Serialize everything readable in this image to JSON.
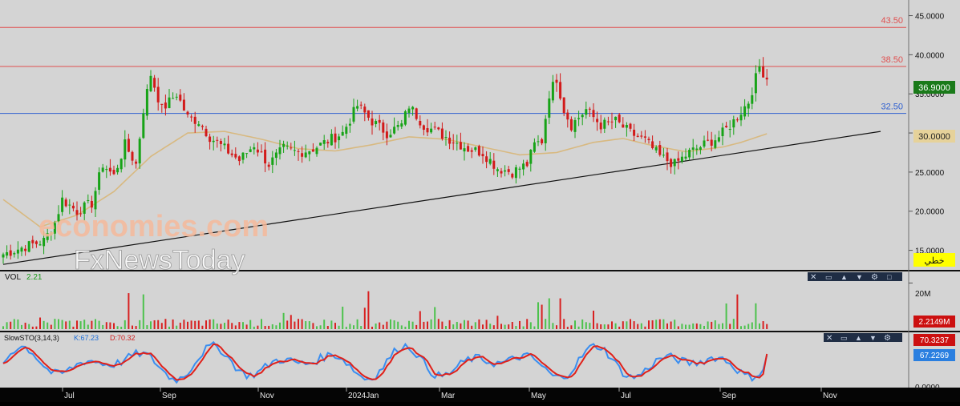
{
  "chart_data": [
    {
      "type": "candlestick",
      "name": "price",
      "ylim": [
        12.5,
        47
      ],
      "y_ticks": [
        "15.0000",
        "20.0000",
        "25.0000",
        "30.0000",
        "35.0000",
        "40.0000",
        "45.0000"
      ],
      "y_tick_values": [
        15,
        20,
        25,
        30,
        35,
        40,
        45
      ],
      "x_ticks": [
        "Jul",
        "Sep",
        "Nov",
        "2024Jan",
        "Mar",
        "May",
        "Jul",
        "Sep",
        "Nov"
      ],
      "last_price": "36.9000",
      "ma_value": "30.0000",
      "levels": [
        {
          "label": "43.50",
          "value": 43.5,
          "color": "#e05050"
        },
        {
          "label": "38.50",
          "value": 38.5,
          "color": "#e05050"
        },
        {
          "label": "32.50",
          "value": 32.5,
          "color": "#3060d0"
        }
      ],
      "trendline": {
        "from": [
          "Jun 2023",
          13.2
        ],
        "to": [
          "Nov 2024",
          30.2
        ]
      },
      "price_path": [
        [
          0,
          14.5
        ],
        [
          6,
          15.5
        ],
        [
          11,
          16.2
        ],
        [
          14,
          18.5
        ],
        [
          16,
          21.5
        ],
        [
          20,
          20.0
        ],
        [
          24,
          21.0
        ],
        [
          27,
          26.0
        ],
        [
          30,
          24.5
        ],
        [
          33,
          28.5
        ],
        [
          36,
          26.0
        ],
        [
          38,
          33.0
        ],
        [
          40,
          37.5
        ],
        [
          43,
          33.0
        ],
        [
          47,
          35.0
        ],
        [
          50,
          32.0
        ],
        [
          53,
          31.5
        ],
        [
          56,
          29.5
        ],
        [
          60,
          28.0
        ],
        [
          64,
          26.5
        ],
        [
          68,
          28.5
        ],
        [
          72,
          26.0
        ],
        [
          76,
          28.0
        ],
        [
          80,
          27.5
        ],
        [
          84,
          28.0
        ],
        [
          88,
          29.0
        ],
        [
          92,
          30.0
        ],
        [
          96,
          33.5
        ],
        [
          100,
          31.5
        ],
        [
          104,
          30.0
        ],
        [
          108,
          31.0
        ],
        [
          110,
          33.5
        ],
        [
          114,
          31.0
        ],
        [
          118,
          30.0
        ],
        [
          122,
          29.0
        ],
        [
          126,
          28.0
        ],
        [
          130,
          27.5
        ],
        [
          134,
          25.5
        ],
        [
          138,
          25.0
        ],
        [
          142,
          26.0
        ],
        [
          144,
          28.5
        ],
        [
          146,
          29.0
        ],
        [
          148,
          35.0
        ],
        [
          150,
          37.0
        ],
        [
          152,
          33.0
        ],
        [
          154,
          31.0
        ],
        [
          158,
          33.0
        ],
        [
          162,
          31.0
        ],
        [
          166,
          31.5
        ],
        [
          170,
          30.0
        ],
        [
          174,
          29.0
        ],
        [
          178,
          27.0
        ],
        [
          182,
          26.0
        ],
        [
          186,
          27.5
        ],
        [
          190,
          28.5
        ],
        [
          194,
          29.5
        ],
        [
          198,
          31.5
        ],
        [
          202,
          34.0
        ],
        [
          205,
          38.5
        ],
        [
          207,
          37.0
        ]
      ],
      "ma_path": [
        [
          0,
          21.5
        ],
        [
          10,
          18.0
        ],
        [
          20,
          19.5
        ],
        [
          30,
          22.5
        ],
        [
          40,
          27.0
        ],
        [
          50,
          30.0
        ],
        [
          60,
          30.2
        ],
        [
          70,
          29.2
        ],
        [
          80,
          28.0
        ],
        [
          90,
          27.7
        ],
        [
          100,
          28.5
        ],
        [
          110,
          29.5
        ],
        [
          120,
          29.2
        ],
        [
          130,
          28.2
        ],
        [
          140,
          27.2
        ],
        [
          150,
          27.5
        ],
        [
          160,
          28.8
        ],
        [
          168,
          29.3
        ],
        [
          175,
          28.5
        ],
        [
          185,
          27.6
        ],
        [
          195,
          28.2
        ],
        [
          200,
          28.8
        ],
        [
          207,
          29.9
        ]
      ]
    },
    {
      "type": "bar",
      "name": "volume",
      "label": "VOL",
      "value": "2.21",
      "y_tick": "20M",
      "last_value": "2.2149M",
      "ylim": [
        0,
        25
      ]
    },
    {
      "type": "line",
      "name": "slow-stochastic",
      "label": "SlowSTO(3,14,3)",
      "k_label": "K:67.23",
      "d_label": "D:70.32",
      "ylim": [
        0,
        100
      ],
      "y_tick": "0.0000",
      "series": [
        {
          "name": "K",
          "last": "67.2269",
          "color": "#3a8ef0"
        },
        {
          "name": "D",
          "last": "70.3237",
          "color": "#e0201a"
        }
      ]
    }
  ],
  "badges": {
    "arabic": "خطي"
  },
  "watermark": {
    "line1": "economies.com",
    "line2": "FxNewsToday"
  }
}
